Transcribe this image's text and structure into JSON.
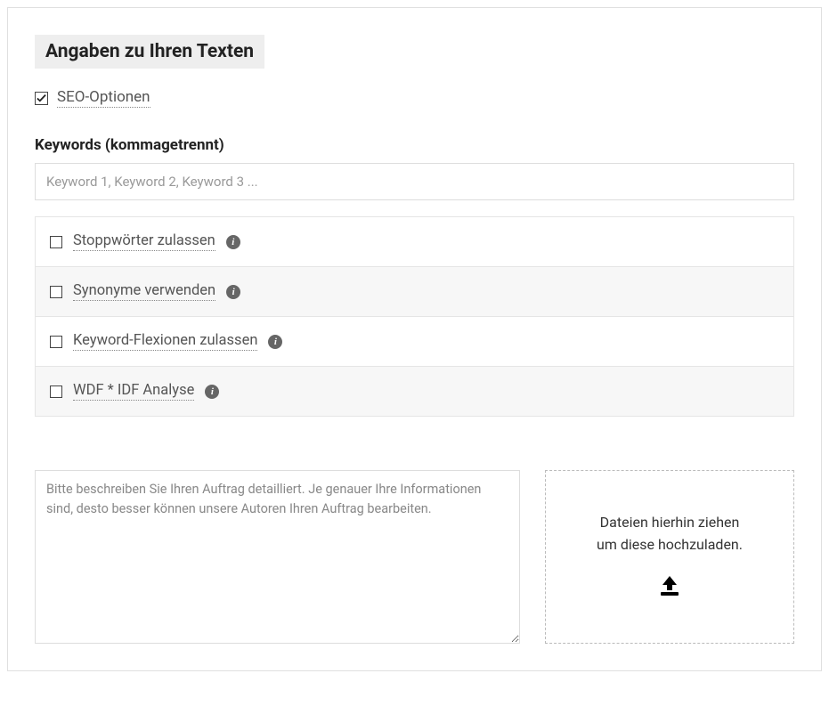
{
  "section_title": "Angaben zu Ihren Texten",
  "seo_options": {
    "label": "SEO-Optionen",
    "checked": true
  },
  "keywords": {
    "label": "Keywords (kommagetrennt)",
    "placeholder": "Keyword 1, Keyword 2, Keyword 3 ...",
    "value": ""
  },
  "options": [
    {
      "label": "Stoppwörter zulassen",
      "checked": false
    },
    {
      "label": "Synonyme verwenden",
      "checked": false
    },
    {
      "label": "Keyword-Flexionen zulassen",
      "checked": false
    },
    {
      "label": "WDF * IDF Analyse",
      "checked": false
    }
  ],
  "description": {
    "placeholder": "Bitte beschreiben Sie Ihren Auftrag detailliert. Je genauer Ihre Informationen sind, desto besser können unsere Autoren Ihren Auftrag bearbeiten.",
    "value": ""
  },
  "dropzone": {
    "line1": "Dateien hierhin ziehen",
    "line2": "um diese hochzuladen."
  },
  "info_glyph": "i"
}
